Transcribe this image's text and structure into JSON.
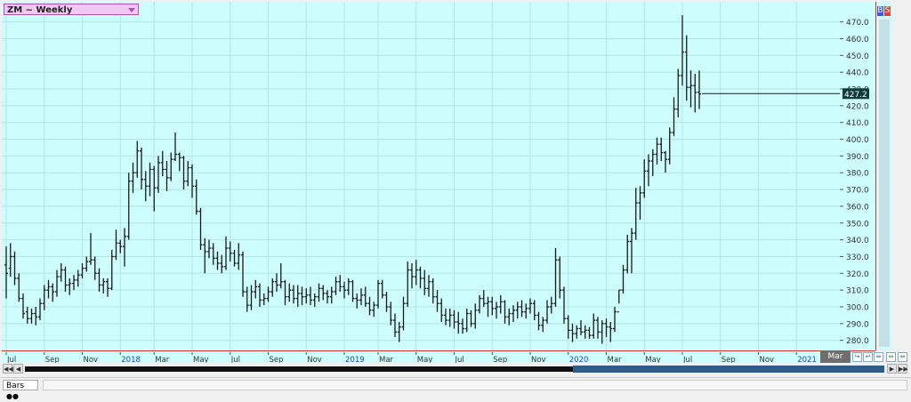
{
  "window": {
    "symbol_label": "ZM ~ Weekly",
    "bs_b": "B",
    "bs_s": "S",
    "mar_label": "Mar",
    "statusbar_tab": "Bars"
  },
  "colors": {
    "background": "#cdfdfd",
    "bars": "#1a1a1a",
    "grid": "#b2e6e6",
    "frame": "#d0342c",
    "year_label": "#1f45d6",
    "last_price_bg": "#0f3b3b"
  },
  "chart_data": {
    "type": "ohlc",
    "title": "ZM ~ Weekly",
    "yaxis": {
      "ticks": [
        280.0,
        290.0,
        300.0,
        310.0,
        320.0,
        330.0,
        340.0,
        350.0,
        360.0,
        370.0,
        380.0,
        390.0,
        400.0,
        410.0,
        420.0,
        430.0,
        440.0,
        450.0,
        460.0,
        470.0
      ],
      "ylim": [
        274,
        482
      ]
    },
    "last_price": 427.2,
    "xaxis": {
      "ticks": [
        {
          "label": "Jul",
          "week": 0,
          "year": false
        },
        {
          "label": "Sep",
          "week": 9,
          "year": false
        },
        {
          "label": "Nov",
          "week": 18,
          "year": false
        },
        {
          "label": "2018",
          "week": 27,
          "year": true
        },
        {
          "label": "Mar",
          "week": 35,
          "year": false
        },
        {
          "label": "May",
          "week": 44,
          "year": false
        },
        {
          "label": "Jul",
          "week": 53,
          "year": false
        },
        {
          "label": "Sep",
          "week": 62,
          "year": false
        },
        {
          "label": "Nov",
          "week": 71,
          "year": false
        },
        {
          "label": "2019",
          "week": 80,
          "year": true
        },
        {
          "label": "Mar",
          "week": 88,
          "year": false
        },
        {
          "label": "May",
          "week": 97,
          "year": false
        },
        {
          "label": "Jul",
          "week": 106,
          "year": false
        },
        {
          "label": "Sep",
          "week": 115,
          "year": false
        },
        {
          "label": "Nov",
          "week": 124,
          "year": false
        },
        {
          "label": "2020",
          "week": 133,
          "year": true
        },
        {
          "label": "Mar",
          "week": 142,
          "year": false
        },
        {
          "label": "May",
          "week": 151,
          "year": false
        },
        {
          "label": "Jul",
          "week": 160,
          "year": false
        },
        {
          "label": "Sep",
          "week": 169,
          "year": false
        },
        {
          "label": "Nov",
          "week": 178,
          "year": false
        },
        {
          "label": "2021",
          "week": 187,
          "year": true
        }
      ]
    },
    "bars": [
      [
        325,
        336,
        305,
        320
      ],
      [
        323,
        338,
        318,
        330
      ],
      [
        330,
        333,
        313,
        317
      ],
      [
        317,
        320,
        303,
        305
      ],
      [
        305,
        308,
        293,
        296
      ],
      [
        297,
        300,
        290,
        293
      ],
      [
        293,
        299,
        290,
        296
      ],
      [
        296,
        300,
        289,
        294
      ],
      [
        294,
        305,
        292,
        302
      ],
      [
        302,
        313,
        298,
        310
      ],
      [
        310,
        316,
        305,
        312
      ],
      [
        312,
        314,
        303,
        309
      ],
      [
        309,
        322,
        306,
        318
      ],
      [
        318,
        326,
        315,
        322
      ],
      [
        322,
        324,
        309,
        313
      ],
      [
        313,
        317,
        307,
        314
      ],
      [
        314,
        319,
        310,
        316
      ],
      [
        316,
        322,
        312,
        319
      ],
      [
        319,
        326,
        317,
        323
      ],
      [
        323,
        330,
        321,
        327
      ],
      [
        327,
        344,
        325,
        328
      ],
      [
        328,
        330,
        316,
        320
      ],
      [
        320,
        323,
        309,
        313
      ],
      [
        313,
        317,
        308,
        315
      ],
      [
        315,
        317,
        306,
        311
      ],
      [
        311,
        334,
        310,
        330
      ],
      [
        330,
        346,
        328,
        338
      ],
      [
        338,
        340,
        332,
        336
      ],
      [
        336,
        347,
        324,
        342
      ],
      [
        342,
        380,
        340,
        375
      ],
      [
        375,
        386,
        368,
        380
      ],
      [
        380,
        399,
        377,
        393
      ],
      [
        393,
        395,
        370,
        376
      ],
      [
        376,
        381,
        363,
        372
      ],
      [
        372,
        386,
        366,
        382
      ],
      [
        382,
        384,
        357,
        371
      ],
      [
        371,
        390,
        368,
        386
      ],
      [
        386,
        393,
        378,
        382
      ],
      [
        382,
        387,
        369,
        377
      ],
      [
        377,
        392,
        375,
        388
      ],
      [
        388,
        404,
        387,
        391
      ],
      [
        391,
        392,
        381,
        389
      ],
      [
        389,
        390,
        370,
        375
      ],
      [
        375,
        387,
        372,
        383
      ],
      [
        383,
        385,
        365,
        372
      ],
      [
        372,
        376,
        355,
        357
      ],
      [
        357,
        359,
        334,
        337
      ],
      [
        337,
        341,
        320,
        333
      ],
      [
        333,
        340,
        329,
        335
      ],
      [
        335,
        338,
        325,
        329
      ],
      [
        329,
        333,
        322,
        326
      ],
      [
        326,
        331,
        320,
        324
      ],
      [
        324,
        342,
        322,
        335
      ],
      [
        335,
        339,
        327,
        332
      ],
      [
        332,
        334,
        324,
        326
      ],
      [
        326,
        338,
        322,
        331
      ],
      [
        331,
        333,
        306,
        309
      ],
      [
        309,
        312,
        297,
        301
      ],
      [
        301,
        313,
        298,
        309
      ],
      [
        309,
        316,
        305,
        312
      ],
      [
        312,
        314,
        300,
        304
      ],
      [
        304,
        308,
        301,
        305
      ],
      [
        305,
        312,
        303,
        309
      ],
      [
        309,
        317,
        306,
        315
      ],
      [
        315,
        320,
        309,
        313
      ],
      [
        313,
        326,
        311,
        315
      ],
      [
        315,
        316,
        301,
        306
      ],
      [
        306,
        314,
        303,
        310
      ],
      [
        310,
        313,
        302,
        305
      ],
      [
        305,
        313,
        300,
        308
      ],
      [
        308,
        312,
        301,
        306
      ],
      [
        306,
        311,
        302,
        307
      ],
      [
        307,
        312,
        301,
        304
      ],
      [
        304,
        308,
        300,
        306
      ],
      [
        306,
        314,
        303,
        311
      ],
      [
        311,
        313,
        304,
        308
      ],
      [
        308,
        310,
        302,
        306
      ],
      [
        306,
        312,
        302,
        309
      ],
      [
        309,
        318,
        307,
        315
      ],
      [
        315,
        319,
        309,
        312
      ],
      [
        312,
        315,
        305,
        310
      ],
      [
        310,
        317,
        307,
        315
      ],
      [
        315,
        316,
        303,
        305
      ],
      [
        305,
        308,
        299,
        304
      ],
      [
        304,
        311,
        301,
        307
      ],
      [
        307,
        312,
        300,
        302
      ],
      [
        302,
        306,
        295,
        298
      ],
      [
        298,
        303,
        294,
        301
      ],
      [
        301,
        316,
        299,
        314
      ],
      [
        314,
        316,
        305,
        307
      ],
      [
        307,
        309,
        297,
        300
      ],
      [
        300,
        303,
        289,
        292
      ],
      [
        292,
        296,
        282,
        285
      ],
      [
        285,
        291,
        279,
        288
      ],
      [
        288,
        306,
        286,
        302
      ],
      [
        302,
        327,
        300,
        322
      ],
      [
        322,
        326,
        311,
        318
      ],
      [
        318,
        328,
        313,
        322
      ],
      [
        322,
        324,
        311,
        317
      ],
      [
        317,
        322,
        307,
        311
      ],
      [
        311,
        319,
        306,
        315
      ],
      [
        315,
        317,
        302,
        306
      ],
      [
        306,
        310,
        297,
        302
      ],
      [
        302,
        305,
        291,
        295
      ],
      [
        295,
        299,
        289,
        292
      ],
      [
        292,
        299,
        288,
        295
      ],
      [
        295,
        298,
        287,
        291
      ],
      [
        291,
        297,
        284,
        290
      ],
      [
        290,
        293,
        284,
        287
      ],
      [
        287,
        299,
        285,
        296
      ],
      [
        296,
        298,
        288,
        290
      ],
      [
        290,
        302,
        287,
        298
      ],
      [
        298,
        307,
        296,
        305
      ],
      [
        305,
        310,
        300,
        302
      ],
      [
        302,
        306,
        294,
        303
      ],
      [
        303,
        306,
        295,
        299
      ],
      [
        299,
        303,
        293,
        300
      ],
      [
        300,
        307,
        296,
        303
      ],
      [
        303,
        304,
        290,
        294
      ],
      [
        294,
        299,
        289,
        296
      ],
      [
        296,
        301,
        291,
        298
      ],
      [
        298,
        303,
        293,
        300
      ],
      [
        300,
        304,
        294,
        297
      ],
      [
        297,
        302,
        293,
        299
      ],
      [
        299,
        305,
        296,
        302
      ],
      [
        302,
        304,
        292,
        295
      ],
      [
        295,
        297,
        286,
        289
      ],
      [
        289,
        294,
        285,
        292
      ],
      [
        292,
        304,
        290,
        300
      ],
      [
        300,
        306,
        296,
        302
      ],
      [
        302,
        335,
        300,
        328
      ],
      [
        328,
        330,
        305,
        310
      ],
      [
        310,
        312,
        290,
        293
      ],
      [
        293,
        295,
        281,
        286
      ],
      [
        286,
        290,
        279,
        284
      ],
      [
        284,
        289,
        281,
        287
      ],
      [
        287,
        292,
        283,
        285
      ],
      [
        285,
        289,
        281,
        286
      ],
      [
        286,
        288,
        281,
        283
      ],
      [
        283,
        296,
        281,
        292
      ],
      [
        292,
        294,
        281,
        285
      ],
      [
        285,
        292,
        278,
        290
      ],
      [
        290,
        293,
        282,
        288
      ],
      [
        288,
        291,
        279,
        287
      ],
      [
        287,
        300,
        285,
        297
      ],
      [
        297,
        310,
        302,
        310
      ],
      [
        310,
        325,
        308,
        322
      ],
      [
        322,
        343,
        320,
        339
      ],
      [
        339,
        347,
        320,
        344
      ],
      [
        344,
        371,
        340,
        362
      ],
      [
        362,
        372,
        352,
        368
      ],
      [
        368,
        388,
        365,
        381
      ],
      [
        381,
        391,
        372,
        387
      ],
      [
        387,
        394,
        378,
        391
      ],
      [
        391,
        401,
        385,
        397
      ],
      [
        397,
        401,
        387,
        392
      ],
      [
        392,
        393,
        380,
        388
      ],
      [
        388,
        407,
        385,
        404
      ],
      [
        404,
        425,
        402,
        418
      ],
      [
        418,
        442,
        413,
        438
      ],
      [
        438,
        474,
        432,
        452
      ],
      [
        452,
        462,
        423,
        431
      ],
      [
        431,
        441,
        419,
        432
      ],
      [
        432,
        439,
        416,
        428
      ],
      [
        428,
        441,
        418,
        427
      ]
    ]
  }
}
